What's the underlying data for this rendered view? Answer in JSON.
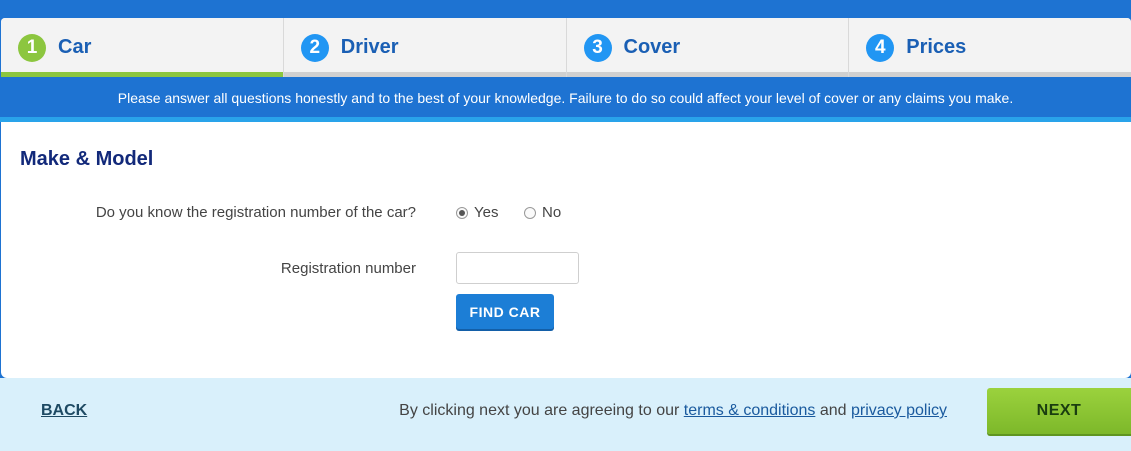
{
  "steps": [
    {
      "num": "1",
      "label": "Car",
      "active": true,
      "color": "#8cc63f"
    },
    {
      "num": "2",
      "label": "Driver",
      "active": false,
      "color": "#2196f3"
    },
    {
      "num": "3",
      "label": "Cover",
      "active": false,
      "color": "#2196f3"
    },
    {
      "num": "4",
      "label": "Prices",
      "active": false,
      "color": "#2196f3"
    }
  ],
  "notice": "Please answer all questions honestly and to the best of your knowledge. Failure to do so could affect your level of cover or any claims you make.",
  "section": {
    "title": "Make & Model",
    "reg_question": "Do you know the registration number of the car?",
    "reg_options": [
      {
        "label": "Yes",
        "checked": true
      },
      {
        "label": "No",
        "checked": false
      }
    ],
    "reg_number_label": "Registration number",
    "reg_number_value": "",
    "find_button": "FIND CAR"
  },
  "footer": {
    "back": "BACK",
    "agree_prefix": "By clicking next you are agreeing to our ",
    "terms": "terms & conditions",
    "and": " and ",
    "privacy": "privacy policy",
    "next": "NEXT"
  },
  "colors": {
    "brand_blue": "#1e73d2",
    "accent_green": "#8cc63f",
    "title_navy": "#12297a"
  }
}
